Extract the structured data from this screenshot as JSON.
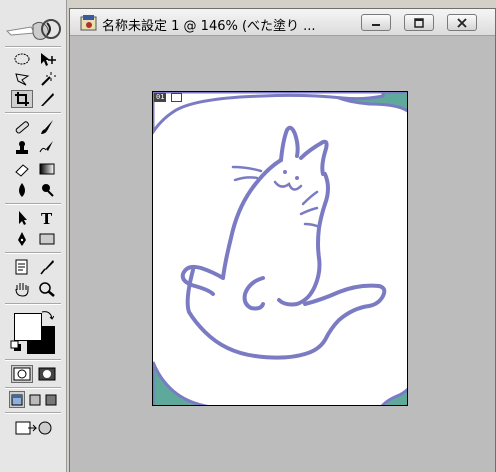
{
  "document": {
    "title": "名称未設定 1 @ 146% (べた塗り ...",
    "page_badge": "01"
  },
  "colors": {
    "foreground": "#ffffff",
    "background": "#000000",
    "line": "#7b7bc4",
    "teal": "#5fa89c",
    "workspace": "#bcbcbc"
  },
  "toolbox": {
    "tools": [
      "elliptical-marquee",
      "move",
      "lasso",
      "magic-wand",
      "crop",
      "slice",
      "healing-brush",
      "brush",
      "clone-stamp",
      "history-brush",
      "eraser",
      "gradient",
      "blur",
      "dodge",
      "path-selection",
      "type",
      "pen",
      "rectangle",
      "notes",
      "eyedropper",
      "hand",
      "zoom"
    ]
  }
}
